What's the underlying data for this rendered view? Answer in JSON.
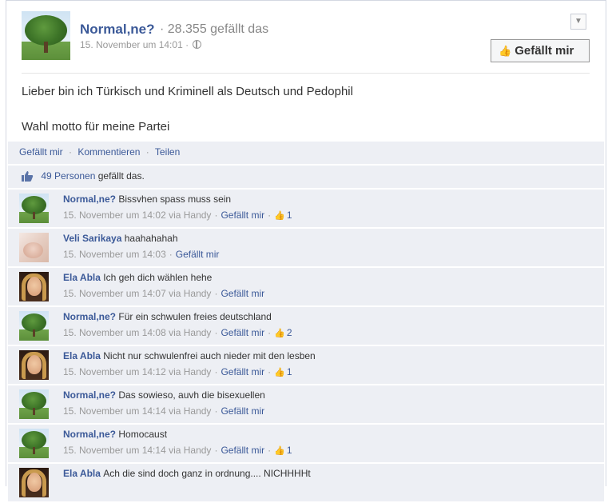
{
  "post": {
    "page_name": "Normal,ne?",
    "page_likes": "· 28.355 gefällt das",
    "date": "15. November um 14:01",
    "meta_separator": "·",
    "like_button_label": "Gefällt mir",
    "text_line1": "Lieber bin ich Türkisch und Kriminell als Deutsch und Pedophil",
    "text_line2": "Wahl motto für meine Partei"
  },
  "actions": {
    "like": "Gefällt mir",
    "comment": "Kommentieren",
    "share": "Teilen",
    "sep": "·"
  },
  "likes_summary": {
    "count_link": "49 Personen",
    "suffix": "gefällt das."
  },
  "comments": [
    {
      "author": "Normal,ne?",
      "text": "Bissvhen spass muss sein",
      "date": "15. November um 14:02 via Handy",
      "like_label": "Gefällt mir",
      "likes": "1",
      "avatar": "tree"
    },
    {
      "author": "Veli Sarikaya",
      "text": "haahahahah",
      "date": "15. November um 14:03",
      "like_label": "Gefällt mir",
      "likes": "",
      "avatar": "face"
    },
    {
      "author": "Ela Abla",
      "text": "Ich geh dich wählen hehe",
      "date": "15. November um 14:07 via Handy",
      "like_label": "Gefällt mir",
      "likes": "",
      "avatar": "hijab"
    },
    {
      "author": "Normal,ne?",
      "text": "Für ein schwulen freies deutschland",
      "date": "15. November um 14:08 via Handy",
      "like_label": "Gefällt mir",
      "likes": "2",
      "avatar": "tree"
    },
    {
      "author": "Ela Abla",
      "text": "Nicht nur schwulenfrei auch nieder mit den lesben",
      "date": "15. November um 14:12 via Handy",
      "like_label": "Gefällt mir",
      "likes": "1",
      "avatar": "hijab"
    },
    {
      "author": "Normal,ne?",
      "text": "Das sowieso, auvh die bisexuellen",
      "date": "15. November um 14:14 via Handy",
      "like_label": "Gefällt mir",
      "likes": "",
      "avatar": "tree"
    },
    {
      "author": "Normal,ne?",
      "text": "Homocaust",
      "date": "15. November um 14:14 via Handy",
      "like_label": "Gefällt mir",
      "likes": "1",
      "avatar": "tree"
    },
    {
      "author": "Ela Abla",
      "text": "Ach die sind doch ganz in ordnung.... NICHHHHt",
      "date": "",
      "like_label": "",
      "likes": "",
      "avatar": "hijab"
    }
  ],
  "colors": {
    "link": "#3b5998",
    "comment_bg": "#edeff4",
    "meta": "#999999"
  },
  "icons": {
    "menu": "chevron-down-icon",
    "like": "thumbs-up-icon",
    "privacy": "globe-icon"
  }
}
